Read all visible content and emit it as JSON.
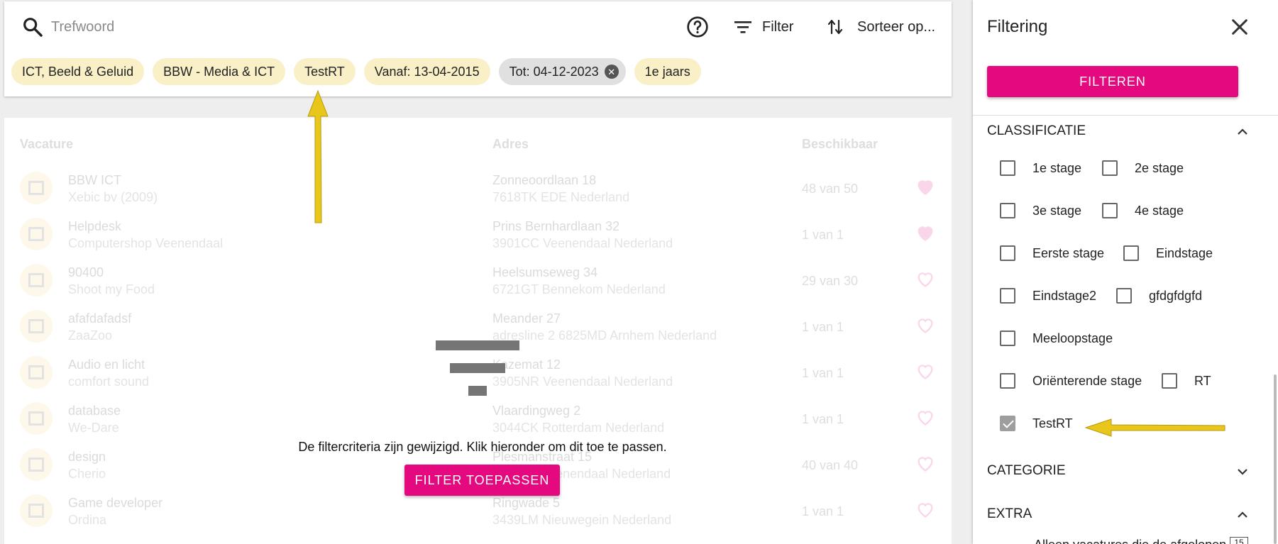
{
  "search": {
    "placeholder": "Trefwoord",
    "filter_label": "Filter",
    "sort_label": "Sorteer op..."
  },
  "chips": [
    {
      "label": "ICT, Beeld & Geluid"
    },
    {
      "label": "BBW - Media & ICT"
    },
    {
      "label": "TestRT"
    },
    {
      "label": "Vanaf: 13-04-2015"
    },
    {
      "label": "Tot: 04-12-2023"
    },
    {
      "label": "1e jaars"
    }
  ],
  "table": {
    "headers": {
      "vacature": "Vacature",
      "adres": "Adres",
      "beschikbaar": "Beschikbaar"
    },
    "rows": [
      {
        "title": "BBW ICT",
        "company": "Xebic bv (2009)",
        "address": "Zonneoordlaan 18",
        "city": "7618TK EDE Nederland",
        "available": "48 van 50",
        "favorite": true
      },
      {
        "title": "Helpdesk",
        "company": "Computershop Veenendaal",
        "address": "Prins Bernhardlaan 32",
        "city": "3901CC Veenendaal Nederland",
        "available": "1 van 1",
        "favorite": true
      },
      {
        "title": "90400",
        "company": "Shoot my Food",
        "address": "Heelsumseweg 34",
        "city": "6721GT Bennekom Nederland",
        "available": "29 van 30",
        "favorite": false
      },
      {
        "title": "afafdafadsf",
        "company": "ZaaZoo",
        "address": "Meander 27",
        "city": "adresline 2 6825MD Arnhem Nederland",
        "available": "1 van 1",
        "favorite": false
      },
      {
        "title": "Audio en licht",
        "company": "comfort sound",
        "address": "Kazemat 12",
        "city": "3905NR Veenendaal Nederland",
        "available": "1 van 1",
        "favorite": false
      },
      {
        "title": "database",
        "company": "We-Dare",
        "address": "Vlaardingweg 2",
        "city": "3044CK Rotterdam Nederland",
        "available": "1 van 1",
        "favorite": false
      },
      {
        "title": "design",
        "company": "Cherio",
        "address": "Plesmanstraat 15",
        "city": "3905KZ Veenendaal Nederland",
        "available": "40 van 40",
        "favorite": false
      },
      {
        "title": "Game developer",
        "company": "Ordina",
        "address": "Ringwade 5",
        "city": "3439LM Nieuwegein Nederland",
        "available": "1 van 1",
        "favorite": false
      }
    ]
  },
  "overlay": {
    "message": "De filtercriteria zijn gewijzigd. Klik hieronder om dit toe te passen.",
    "button": "FILTER TOEPASSEN"
  },
  "panel": {
    "title": "Filtering",
    "filter_button": "FILTEREN",
    "sections": {
      "classificatie": "CLASSIFICATIE",
      "categorie": "CATEGORIE",
      "extra": "EXTRA"
    },
    "checkboxes": [
      {
        "label": "1e stage",
        "checked": false
      },
      {
        "label": "2e stage",
        "checked": false
      },
      {
        "label": "3e stage",
        "checked": false
      },
      {
        "label": "4e stage",
        "checked": false
      },
      {
        "label": "Eerste stage",
        "checked": false
      },
      {
        "label": "Eindstage",
        "checked": false
      },
      {
        "label": "Eindstage2",
        "checked": false
      },
      {
        "label": "gfdgfdgfd",
        "checked": false
      },
      {
        "label": "Meeloopstage",
        "checked": false
      },
      {
        "label": "Oriënterende stage",
        "checked": false
      },
      {
        "label": "RT",
        "checked": false
      },
      {
        "label": "TestRT",
        "checked": true
      }
    ],
    "extra_text": "Alleen vacatures die de afgelopen",
    "extra_value": "15"
  },
  "colors": {
    "accent": "#e5097f",
    "chip": "#faf0c8",
    "arrow": "#e8c61a"
  }
}
